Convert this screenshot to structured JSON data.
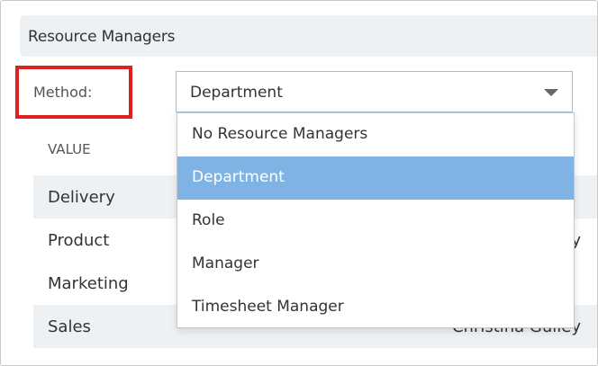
{
  "section": {
    "title": "Resource Managers"
  },
  "method": {
    "label": "Method:",
    "selected_value": "Department"
  },
  "dropdown": {
    "options": [
      {
        "label": "No Resource Managers"
      },
      {
        "label": "Department"
      },
      {
        "label": "Role"
      },
      {
        "label": "Manager"
      },
      {
        "label": "Timesheet Manager"
      }
    ]
  },
  "table": {
    "column_value": "VALUE",
    "rows": [
      {
        "value": "Delivery",
        "right": ""
      },
      {
        "value": "Product",
        "right": "y"
      },
      {
        "value": "Marketing",
        "right": ""
      },
      {
        "value": "Sales",
        "right": "Christina Gulley"
      }
    ]
  },
  "colors": {
    "highlight": "#e02020",
    "selected_option": "#7fb3e3",
    "row_shade": "#eef1f4"
  }
}
